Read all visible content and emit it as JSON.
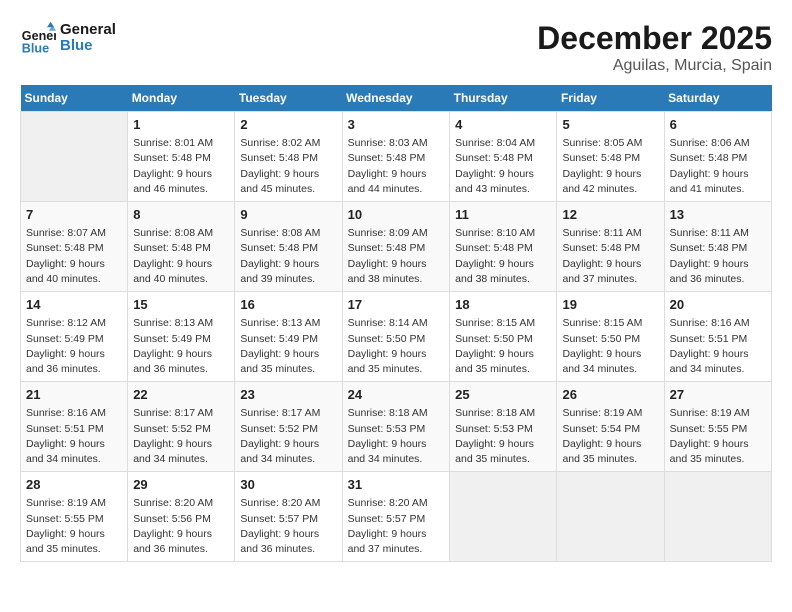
{
  "header": {
    "logo_line1": "General",
    "logo_line2": "Blue",
    "month_year": "December 2025",
    "location": "Aguilas, Murcia, Spain"
  },
  "days_of_week": [
    "Sunday",
    "Monday",
    "Tuesday",
    "Wednesday",
    "Thursday",
    "Friday",
    "Saturday"
  ],
  "weeks": [
    [
      {
        "day": "",
        "info": ""
      },
      {
        "day": "1",
        "info": "Sunrise: 8:01 AM\nSunset: 5:48 PM\nDaylight: 9 hours\nand 46 minutes."
      },
      {
        "day": "2",
        "info": "Sunrise: 8:02 AM\nSunset: 5:48 PM\nDaylight: 9 hours\nand 45 minutes."
      },
      {
        "day": "3",
        "info": "Sunrise: 8:03 AM\nSunset: 5:48 PM\nDaylight: 9 hours\nand 44 minutes."
      },
      {
        "day": "4",
        "info": "Sunrise: 8:04 AM\nSunset: 5:48 PM\nDaylight: 9 hours\nand 43 minutes."
      },
      {
        "day": "5",
        "info": "Sunrise: 8:05 AM\nSunset: 5:48 PM\nDaylight: 9 hours\nand 42 minutes."
      },
      {
        "day": "6",
        "info": "Sunrise: 8:06 AM\nSunset: 5:48 PM\nDaylight: 9 hours\nand 41 minutes."
      }
    ],
    [
      {
        "day": "7",
        "info": "Sunrise: 8:07 AM\nSunset: 5:48 PM\nDaylight: 9 hours\nand 40 minutes."
      },
      {
        "day": "8",
        "info": "Sunrise: 8:08 AM\nSunset: 5:48 PM\nDaylight: 9 hours\nand 40 minutes."
      },
      {
        "day": "9",
        "info": "Sunrise: 8:08 AM\nSunset: 5:48 PM\nDaylight: 9 hours\nand 39 minutes."
      },
      {
        "day": "10",
        "info": "Sunrise: 8:09 AM\nSunset: 5:48 PM\nDaylight: 9 hours\nand 38 minutes."
      },
      {
        "day": "11",
        "info": "Sunrise: 8:10 AM\nSunset: 5:48 PM\nDaylight: 9 hours\nand 38 minutes."
      },
      {
        "day": "12",
        "info": "Sunrise: 8:11 AM\nSunset: 5:48 PM\nDaylight: 9 hours\nand 37 minutes."
      },
      {
        "day": "13",
        "info": "Sunrise: 8:11 AM\nSunset: 5:48 PM\nDaylight: 9 hours\nand 36 minutes."
      }
    ],
    [
      {
        "day": "14",
        "info": "Sunrise: 8:12 AM\nSunset: 5:49 PM\nDaylight: 9 hours\nand 36 minutes."
      },
      {
        "day": "15",
        "info": "Sunrise: 8:13 AM\nSunset: 5:49 PM\nDaylight: 9 hours\nand 36 minutes."
      },
      {
        "day": "16",
        "info": "Sunrise: 8:13 AM\nSunset: 5:49 PM\nDaylight: 9 hours\nand 35 minutes."
      },
      {
        "day": "17",
        "info": "Sunrise: 8:14 AM\nSunset: 5:50 PM\nDaylight: 9 hours\nand 35 minutes."
      },
      {
        "day": "18",
        "info": "Sunrise: 8:15 AM\nSunset: 5:50 PM\nDaylight: 9 hours\nand 35 minutes."
      },
      {
        "day": "19",
        "info": "Sunrise: 8:15 AM\nSunset: 5:50 PM\nDaylight: 9 hours\nand 34 minutes."
      },
      {
        "day": "20",
        "info": "Sunrise: 8:16 AM\nSunset: 5:51 PM\nDaylight: 9 hours\nand 34 minutes."
      }
    ],
    [
      {
        "day": "21",
        "info": "Sunrise: 8:16 AM\nSunset: 5:51 PM\nDaylight: 9 hours\nand 34 minutes."
      },
      {
        "day": "22",
        "info": "Sunrise: 8:17 AM\nSunset: 5:52 PM\nDaylight: 9 hours\nand 34 minutes."
      },
      {
        "day": "23",
        "info": "Sunrise: 8:17 AM\nSunset: 5:52 PM\nDaylight: 9 hours\nand 34 minutes."
      },
      {
        "day": "24",
        "info": "Sunrise: 8:18 AM\nSunset: 5:53 PM\nDaylight: 9 hours\nand 34 minutes."
      },
      {
        "day": "25",
        "info": "Sunrise: 8:18 AM\nSunset: 5:53 PM\nDaylight: 9 hours\nand 35 minutes."
      },
      {
        "day": "26",
        "info": "Sunrise: 8:19 AM\nSunset: 5:54 PM\nDaylight: 9 hours\nand 35 minutes."
      },
      {
        "day": "27",
        "info": "Sunrise: 8:19 AM\nSunset: 5:55 PM\nDaylight: 9 hours\nand 35 minutes."
      }
    ],
    [
      {
        "day": "28",
        "info": "Sunrise: 8:19 AM\nSunset: 5:55 PM\nDaylight: 9 hours\nand 35 minutes."
      },
      {
        "day": "29",
        "info": "Sunrise: 8:20 AM\nSunset: 5:56 PM\nDaylight: 9 hours\nand 36 minutes."
      },
      {
        "day": "30",
        "info": "Sunrise: 8:20 AM\nSunset: 5:57 PM\nDaylight: 9 hours\nand 36 minutes."
      },
      {
        "day": "31",
        "info": "Sunrise: 8:20 AM\nSunset: 5:57 PM\nDaylight: 9 hours\nand 37 minutes."
      },
      {
        "day": "",
        "info": ""
      },
      {
        "day": "",
        "info": ""
      },
      {
        "day": "",
        "info": ""
      }
    ]
  ]
}
